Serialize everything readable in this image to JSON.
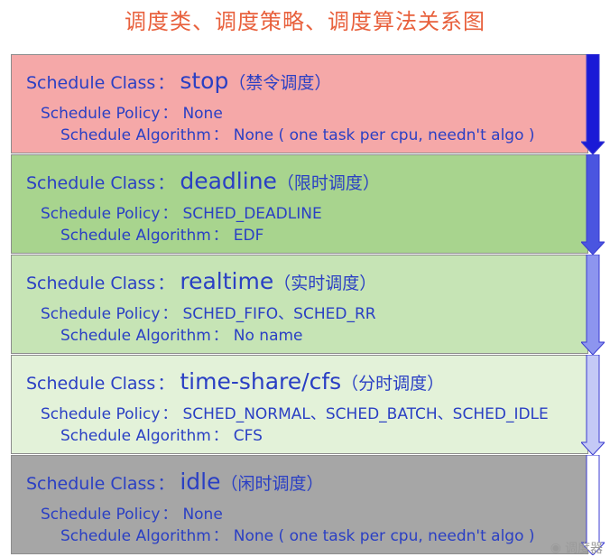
{
  "title": "调度类、调度策略、调度算法关系图",
  "labels": {
    "class": "Schedule Class",
    "policy": "Schedule Policy",
    "algorithm": "Schedule Algorithm",
    "colon": "："
  },
  "bands": [
    {
      "color": "#f5a8a8",
      "class_name": "stop",
      "class_cn": "（禁令调度）",
      "policy": "None",
      "algorithm": "None ( one task per cpu, needn't algo )",
      "arrow_color": "#1a1ad6"
    },
    {
      "color": "#a8d48e",
      "class_name": "deadline",
      "class_cn": "（限时调度）",
      "policy": "SCHED_DEADLINE",
      "algorithm": "EDF",
      "arrow_color": "#4a55e0"
    },
    {
      "color": "#c6e4b5",
      "class_name": "realtime",
      "class_cn": "（实时调度）",
      "policy": "SCHED_FIFO、SCHED_RR",
      "algorithm": "No name",
      "arrow_color": "#8d95ef"
    },
    {
      "color": "#e3f2d9",
      "class_name": "time-share/cfs",
      "class_cn": "（分时调度）",
      "policy": "SCHED_NORMAL、SCHED_BATCH、SCHED_IDLE",
      "algorithm": "CFS",
      "arrow_color": "#c4c9f6"
    },
    {
      "color": "#a6a6a6",
      "class_name": "idle",
      "class_cn": "（闲时调度）",
      "policy": "None",
      "algorithm": "None ( one task per cpu, needn't algo )",
      "arrow_color": "#ffffff"
    }
  ],
  "watermark": "调度器"
}
